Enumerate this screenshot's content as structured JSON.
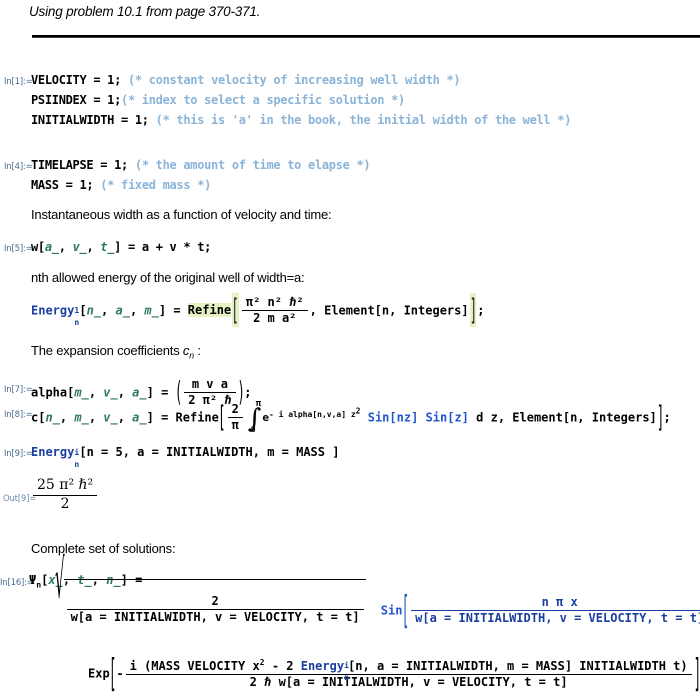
{
  "document": {
    "title_note": "Using problem 10.1 from page 370-371."
  },
  "cells": {
    "in1": {
      "label": "In[1]:=",
      "lines": [
        {
          "code": "VELOCITY = 1;",
          "comment": "(* constant velocity of increasing well width *)"
        },
        {
          "code": "PSIINDEX = 1;",
          "comment": "(* index to select a specific solution *)"
        },
        {
          "code": "INITIALWIDTH = 1;",
          "comment": "(* this is 'a' in the book, the initial width of the well *)"
        }
      ]
    },
    "in4": {
      "label": "In[4]:=",
      "lines": [
        {
          "code": "TIMELAPSE = 1;",
          "comment": "(* the amount of time to elapse *)"
        },
        {
          "code": "MASS = 1;",
          "comment": "(* fixed mass *)"
        }
      ]
    },
    "prose1": "Instantaneous width as a function of velocity and time:",
    "in5": {
      "label": "In[5]:=",
      "code_head": "w[",
      "args": [
        "a_",
        "v_",
        "t_"
      ],
      "code_tail": "] = a + v * t;"
    },
    "prose2": "nth allowed energy of the original well of width=a:",
    "energy_def": {
      "name": "Energy",
      "sub": "n",
      "sup": "1",
      "args": [
        "n_",
        "a_",
        "m_"
      ],
      "assign": "=",
      "refine": "Refine",
      "numerator": "π² n² ℏ²",
      "denominator": "2 m a²",
      "condition": "Element[n, Integers]",
      "terminator": ";"
    },
    "prose3_pre": "The expansion coefficients ",
    "prose3_sym": "c",
    "prose3_sub": "n",
    "prose3_post": " :",
    "in7": {
      "label": "In[7]:=",
      "name": "alpha[",
      "args": [
        "m_",
        "v_",
        "a_"
      ],
      "assign": "] =",
      "numerator": "m v a",
      "denominator": "2 π² ℏ",
      "terminator": ";"
    },
    "in8": {
      "label": "In[8]:=",
      "name": "c[",
      "args": [
        "n_",
        "m_",
        "v_",
        "a_"
      ],
      "assign": "] = Refine",
      "frac_num": "2",
      "frac_den": "π",
      "int_upper": "π",
      "int_lower": "0",
      "integrand_exp_base": "e",
      "integrand_exp_sup": "- i alpha[n,v,a] z",
      "integrand_exp_sup2": "2",
      "integrand_sin1": "Sin[nz]",
      "integrand_sin2": "Sin[z]",
      "differential": "d z",
      "condition": "Element[n, Integers]",
      "terminator": ";"
    },
    "in9": {
      "label": "In[9]:=",
      "name": "Energy",
      "sub": "n",
      "sup": "i",
      "call": "[n = 5, a = INITIALWIDTH, m = MASS ]"
    },
    "out9": {
      "label": "Out[9]=",
      "numerator": "25 π² ℏ²",
      "denominator": "2"
    },
    "prose4": "Complete set of solutions:",
    "in16": {
      "label": "In[16]:=",
      "psi": "Ψ",
      "psi_sub": "n",
      "open": "[",
      "args": [
        "x_",
        "t_",
        "n_"
      ],
      "close": "] =",
      "sqrt_num": "2",
      "sqrt_den": "w[a = INITIALWIDTH, v = VELOCITY, t = t]",
      "sin_label": "Sin",
      "sin_num": "n π x",
      "sin_den": "w[a = INITIALWIDTH, v = VELOCITY, t = t]",
      "exp_label": "Exp",
      "exp_minus": "-",
      "exp_i": "i",
      "exp_num_a": "(MASS VELOCITY x",
      "exp_num_a_sup": "2",
      "exp_num_b": " - 2 ",
      "exp_energy": "Energy",
      "exp_energy_sub": "n",
      "exp_energy_sup": "i",
      "exp_num_c": "[n, a = INITIALWIDTH, m = MASS] INITIALWIDTH t)",
      "exp_den": "2 ℏ w[a = INITIALWIDTH,  v = VELOCITY,  t = t]",
      "terminator": ";"
    }
  },
  "colors": {
    "comment": "#8ab4d8",
    "symbol_blue": "#1a3fa0",
    "function_blue": "#2255cc",
    "pattern_green": "#2f7a5f",
    "io_label": "#4a6c8f",
    "refine_highlight": "#e6f2c4"
  }
}
